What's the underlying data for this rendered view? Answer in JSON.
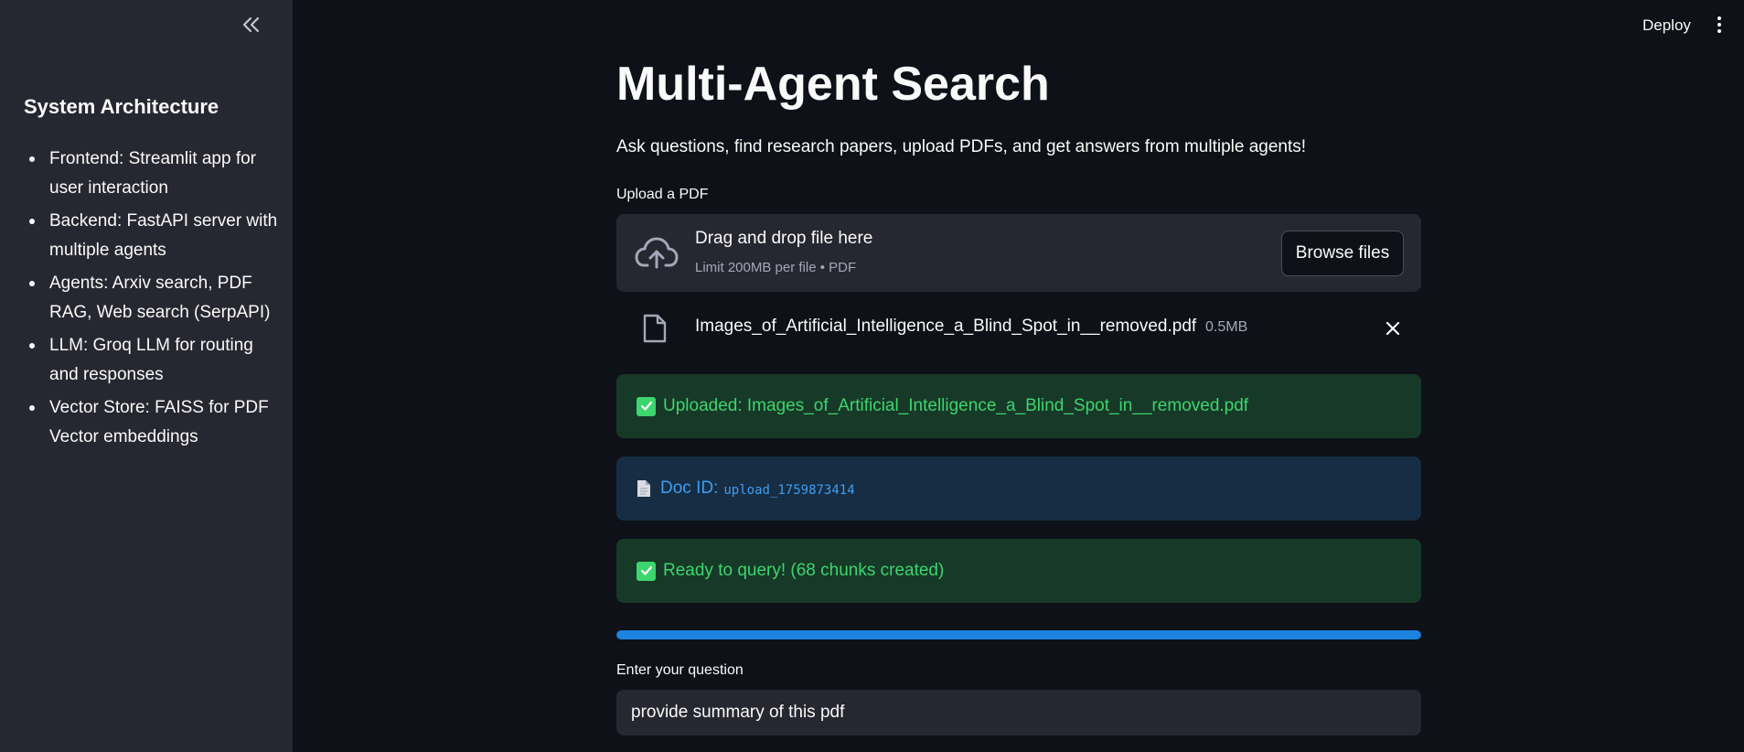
{
  "sidebar": {
    "title": "System Architecture",
    "items": [
      {
        "label": "Frontend: Streamlit app for user interaction"
      },
      {
        "label": "Backend: FastAPI server with multiple agents"
      },
      {
        "label": "Agents: Arxiv search, PDF RAG, Web search (SerpAPI)"
      },
      {
        "label": "LLM: Groq LLM for routing and responses"
      },
      {
        "label": "Vector Store: FAISS for PDF Vector embeddings"
      }
    ]
  },
  "topbar": {
    "deploy_label": "Deploy"
  },
  "main": {
    "title": "Multi-Agent Search",
    "subtitle": "Ask questions, find research papers, upload PDFs, and get answers from multiple agents!",
    "upload": {
      "label": "Upload a PDF",
      "drop_title": "Drag and drop file here",
      "drop_limit": "Limit 200MB per file • PDF",
      "browse_label": "Browse files"
    },
    "file": {
      "name": "Images_of_Artificial_Intelligence_a_Blind_Spot_in__removed.pdf",
      "size": "0.5MB"
    },
    "alerts": {
      "uploaded": "Uploaded: Images_of_Artificial_Intelligence_a_Blind_Spot_in__removed.pdf",
      "doc_id_label": "Doc ID:",
      "doc_id_value": "upload_1759873414",
      "ready": "Ready to query! (68 chunks created)"
    },
    "progress_percent": 100,
    "question": {
      "label": "Enter your question",
      "value": "provide summary of this pdf"
    }
  },
  "colors": {
    "background": "#0e1117",
    "sidebar": "#262730",
    "success_bg": "#173928",
    "success_text": "#3dd56d",
    "info_bg": "#172d43",
    "info_text": "#3d9df3",
    "progress": "#1c83e1"
  },
  "icons": {
    "collapse": "double-chevron-left-icon",
    "menu": "kebab-menu-icon",
    "upload": "cloud-upload-icon",
    "file": "file-icon",
    "close": "close-icon",
    "check": "check-box-icon",
    "doc": "document-icon"
  }
}
